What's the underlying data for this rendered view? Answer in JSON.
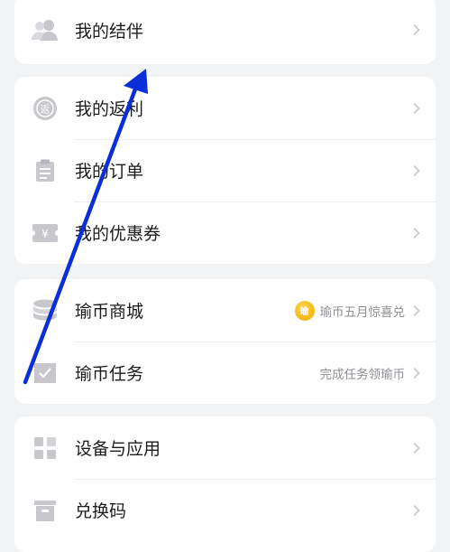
{
  "menu": {
    "group1": [
      {
        "label": "我的结伴",
        "icon": "partners-icon"
      }
    ],
    "group2": [
      {
        "label": "我的返利",
        "icon": "rebate-icon"
      },
      {
        "label": "我的订单",
        "icon": "order-icon"
      },
      {
        "label": "我的优惠券",
        "icon": "coupon-icon"
      }
    ],
    "group3": [
      {
        "label": "瑜币商城",
        "icon": "coin-stack-icon",
        "right_text": "瑜币五月惊喜兑",
        "badge_icon": "yu-coin-icon",
        "badge_char": "瑜"
      },
      {
        "label": "瑜币任务",
        "icon": "task-flag-icon",
        "right_text": "完成任务领瑜币"
      }
    ],
    "group4": [
      {
        "label": "设备与应用",
        "icon": "apps-icon"
      },
      {
        "label": "兑换码",
        "icon": "redeem-code-icon"
      }
    ]
  },
  "annotation": {
    "type": "arrow",
    "color": "#0a2fd6"
  },
  "colors": {
    "background": "#f2f3f5",
    "card": "#ffffff",
    "text": "#1c1c1e",
    "secondary": "#8e8e93",
    "icon": "#c7c7cc"
  }
}
